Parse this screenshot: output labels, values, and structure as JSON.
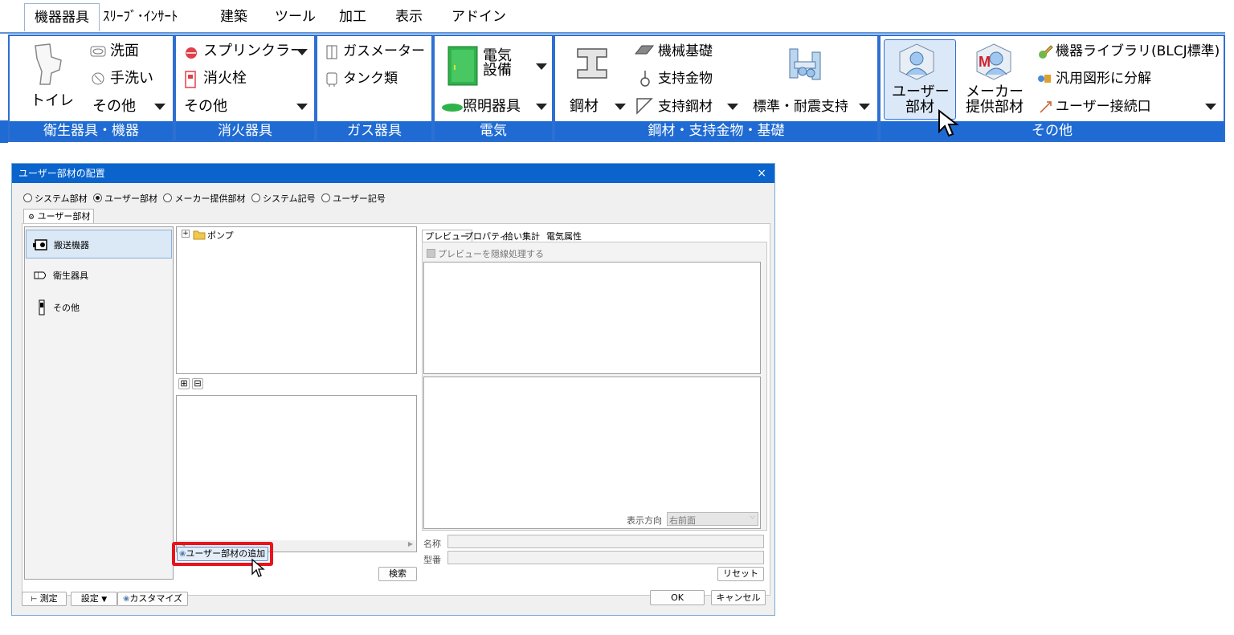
{
  "menu": {
    "tabs": [
      "機器器具",
      "ｽﾘｰﾌﾞ･ｲﾝｻｰﾄ",
      "建築",
      "ツール",
      "加工",
      "表示",
      "アドイン"
    ]
  },
  "ribbon": {
    "sanitary": {
      "toilet": "トイレ",
      "washbasin": "洗面",
      "handwash": "手洗い",
      "other": "その他",
      "label": "衛生器具・機器"
    },
    "fire": {
      "sprinkler": "スプリンクラー",
      "hydrant": "消火栓",
      "other": "その他",
      "label": "消火器具"
    },
    "gas": {
      "meter": "ガスメーター",
      "tank": "タンク類",
      "label": "ガス器具"
    },
    "electric": {
      "equipment_line1": "電気",
      "equipment_line2": "設備",
      "lighting": "照明器具",
      "label": "電気"
    },
    "steel": {
      "steel": "鋼材",
      "machine_base": "機械基礎",
      "support_hardware": "支持金物",
      "support_steel": "支持鋼材",
      "seismic_support": "標準・耐震支持",
      "label": "鋼材・支持金物・基礎"
    },
    "other": {
      "user_part_line1": "ユーザー",
      "user_part_line2": "部材",
      "maker_part_line1": "メーカー",
      "maker_part_line2": "提供部材",
      "library": "機器ライブラリ(BLCJ標準)",
      "decompose": "汎用図形に分解",
      "user_connect": "ユーザー接続口",
      "label": "その他"
    }
  },
  "dialog": {
    "title": "ユーザー部材の配置",
    "close": "×",
    "radios": [
      "システム部材",
      "ユーザー部材",
      "メーカー提供部材",
      "システム記号",
      "ユーザー記号"
    ],
    "selected_radio": "ユーザー部材",
    "tab": "ユーザー部材",
    "categories": [
      "搬送機器",
      "衛生器具",
      "その他"
    ],
    "tree_item": "ポンプ",
    "expand_all": "⊞",
    "collapse_all": "⊟",
    "preview_tabs": [
      "プレビュー",
      "プロパティ",
      "拾い集計",
      "電気属性"
    ],
    "hidden_line_checkbox": "プレビューを隠線処理する",
    "view_direction_label": "表示方向",
    "view_direction_value": "右前面",
    "name_label": "名称",
    "model_label": "型番",
    "add_user_part": "ユーザー部材の追加",
    "search": "検索",
    "reset": "リセット",
    "measure": "測定",
    "settings": "設定",
    "customize": "カスタマイズ",
    "ok": "OK",
    "cancel": "キャンセル"
  },
  "colors": {
    "ribbon_blue": "#1f6bd3",
    "title_blue": "#0a64cc",
    "highlight_red": "#e8141b"
  }
}
